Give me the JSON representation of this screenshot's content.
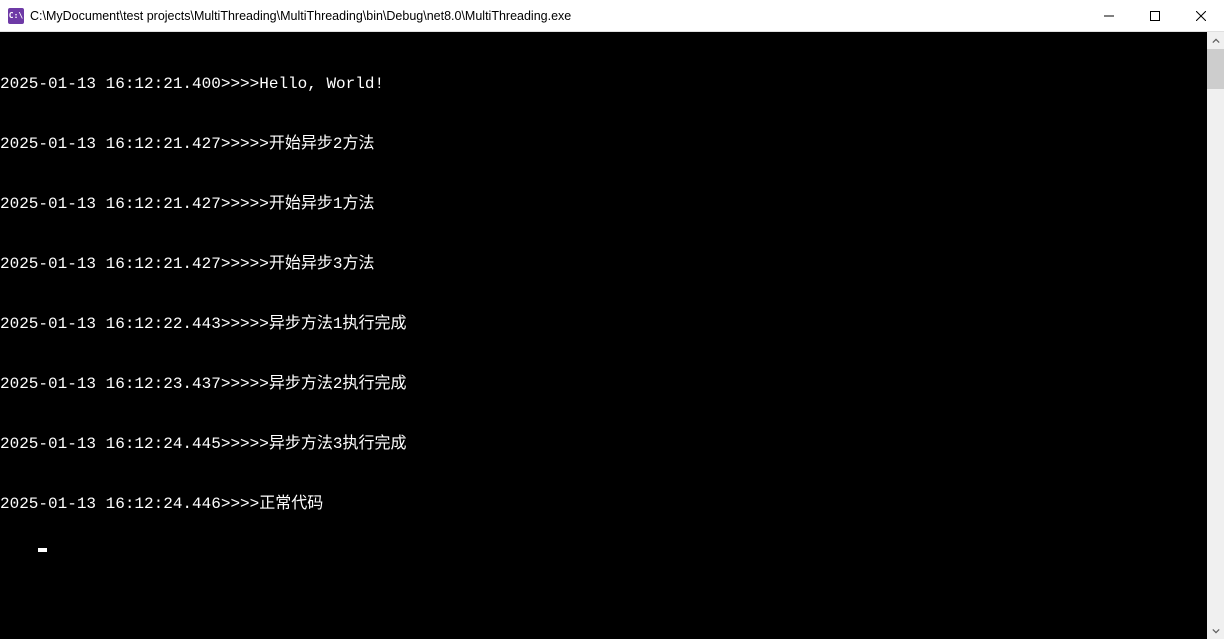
{
  "window": {
    "title": "C:\\MyDocument\\test projects\\MultiThreading\\MultiThreading\\bin\\Debug\\net8.0\\MultiThreading.exe",
    "icon_label": "C:\\"
  },
  "console": {
    "lines": [
      "2025-01-13 16:12:21.400>>>>Hello, World!",
      "2025-01-13 16:12:21.427>>>>>开始异步2方法",
      "2025-01-13 16:12:21.427>>>>>开始异步1方法",
      "2025-01-13 16:12:21.427>>>>>开始异步3方法",
      "2025-01-13 16:12:22.443>>>>>异步方法1执行完成",
      "2025-01-13 16:12:23.437>>>>>异步方法2执行完成",
      "2025-01-13 16:12:24.445>>>>>异步方法3执行完成",
      "2025-01-13 16:12:24.446>>>>正常代码"
    ]
  }
}
